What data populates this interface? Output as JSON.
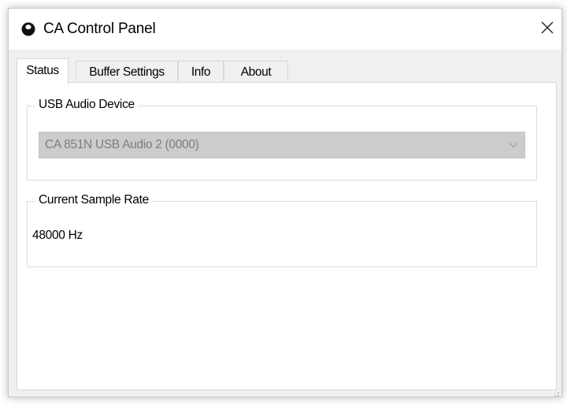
{
  "window": {
    "title": "CA Control Panel",
    "app_icon": "ca-logo-icon",
    "close_icon": "close-icon"
  },
  "tabs": [
    {
      "label": "Status",
      "active": true
    },
    {
      "label": "Buffer Settings",
      "active": false
    },
    {
      "label": "Info",
      "active": false
    },
    {
      "label": "About",
      "active": false
    }
  ],
  "status": {
    "usb_group": {
      "legend": "USB Audio Device",
      "selected_device": "CA 851N USB Audio 2 (0000)",
      "disabled": true
    },
    "rate_group": {
      "legend": "Current Sample Rate",
      "value": "48000 Hz"
    }
  },
  "colors": {
    "client_bg": "#f0f0f0",
    "panel_bg": "#ffffff",
    "combo_disabled_bg": "#cccccc",
    "combo_disabled_text": "#7d7d7d"
  }
}
